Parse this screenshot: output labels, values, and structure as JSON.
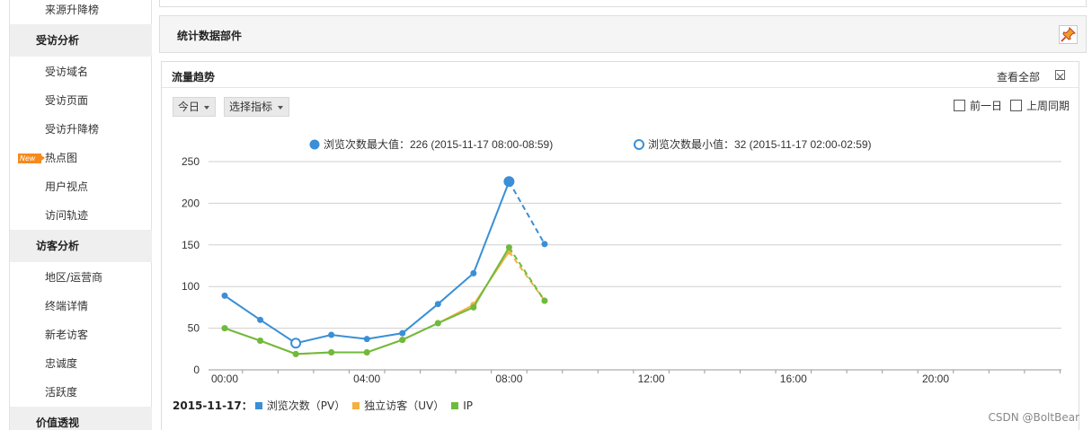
{
  "sidebar": {
    "top_item": "来源升降榜",
    "groups": [
      {
        "title": "受访分析",
        "items": [
          "受访域名",
          "受访页面",
          "受访升降榜",
          "热点图",
          "用户视点",
          "访问轨迹"
        ]
      },
      {
        "title": "访客分析",
        "items": [
          "地区/运营商",
          "终端详情",
          "新老访客",
          "忠诚度",
          "活跃度"
        ]
      },
      {
        "title": "价值透视",
        "items": []
      }
    ],
    "new_badge": "New"
  },
  "widget_bar": {
    "title": "统计数据部件"
  },
  "panel": {
    "title": "流量趋势",
    "view_all": "查看全部",
    "dropdowns": [
      "今日",
      "选择指标"
    ],
    "checkboxes": [
      "前一日",
      "上周同期"
    ],
    "max_note": "浏览次数最大值：226 (2015-11-17 08:00-08:59)",
    "min_note": "浏览次数最小值：32 (2015-11-17 02:00-02:59)"
  },
  "chart_data": {
    "type": "line",
    "x": [
      "00:00",
      "01:00",
      "02:00",
      "03:00",
      "04:00",
      "05:00",
      "06:00",
      "07:00",
      "08:00",
      "09:00"
    ],
    "x_tick_labels": [
      "00:00",
      "04:00",
      "08:00",
      "12:00",
      "16:00",
      "20:00"
    ],
    "y_ticks": [
      0,
      50,
      100,
      150,
      200,
      250
    ],
    "ylim": [
      0,
      250
    ],
    "x_range_hours": [
      0,
      24
    ],
    "series": [
      {
        "name": "浏览次数（PV）",
        "color": "#3a8fd6",
        "values": [
          89,
          60,
          32,
          42,
          37,
          44,
          79,
          116,
          226,
          151
        ]
      },
      {
        "name": "独立访客（UV）",
        "color": "#f5b041",
        "values": [
          50,
          35,
          19,
          21,
          21,
          36,
          56,
          78,
          142,
          83
        ]
      },
      {
        "name": "IP",
        "color": "#6dbb3d",
        "values": [
          50,
          35,
          19,
          21,
          21,
          36,
          56,
          75,
          147,
          83
        ]
      }
    ],
    "last_segment_dashed": true,
    "max_point": {
      "series": "浏览次数（PV）",
      "x": "08:00",
      "value": 226
    },
    "min_point": {
      "series": "浏览次数（PV）",
      "x": "02:00",
      "value": 32
    },
    "legend_date": "2015-11-17：",
    "grid": true
  },
  "watermark": "CSDN @BoltBear"
}
